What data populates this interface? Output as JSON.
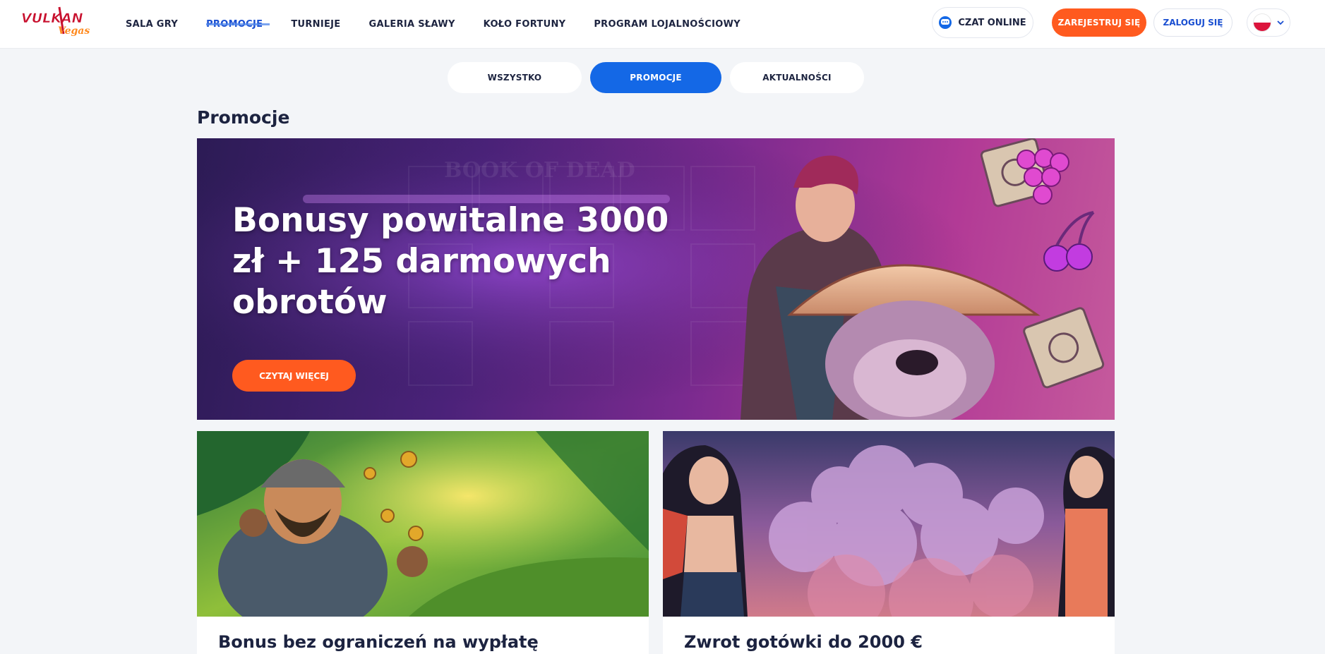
{
  "header": {
    "logo_text": "VULKAN",
    "logo_subtext": "Vegas",
    "nav": [
      {
        "label": "SALA GRY"
      },
      {
        "label": "PROMOCJE"
      },
      {
        "label": "TURNIEJE"
      },
      {
        "label": "GALERIA SŁAWY"
      },
      {
        "label": "KOŁO FORTUNY"
      },
      {
        "label": "PROGRAM LOJALNOŚCIOWY"
      }
    ],
    "active_nav": "PROMOCJE",
    "chat_label": "CZAT ONLINE",
    "register_label": "ZAREJESTRUJ SIĘ",
    "login_label": "ZALOGUJ SIĘ",
    "language_flag": "flag-pl-icon"
  },
  "tabs": [
    {
      "label": "WSZYSTKO"
    },
    {
      "label": "PROMOCJE"
    },
    {
      "label": "AKTUALNOŚCI"
    }
  ],
  "active_tab": "PROMOCJE",
  "page_title": "Promocje",
  "hero": {
    "title": "Bonusy powitalne 3000 zł + 125 darmowych obrotów",
    "button_label": "CZYTAJ WIĘCEJ",
    "background_text": "BOOK OF DEAD"
  },
  "cards": [
    {
      "title": "Bonus bez ograniczeń na wypłatę"
    },
    {
      "title": "Zwrot gotówki do 2000 €"
    }
  ],
  "colors": {
    "accent_orange": "#ff5a1f",
    "accent_blue": "#1468e6",
    "text_dark": "#1c2340",
    "page_bg": "#f3f5f8"
  }
}
